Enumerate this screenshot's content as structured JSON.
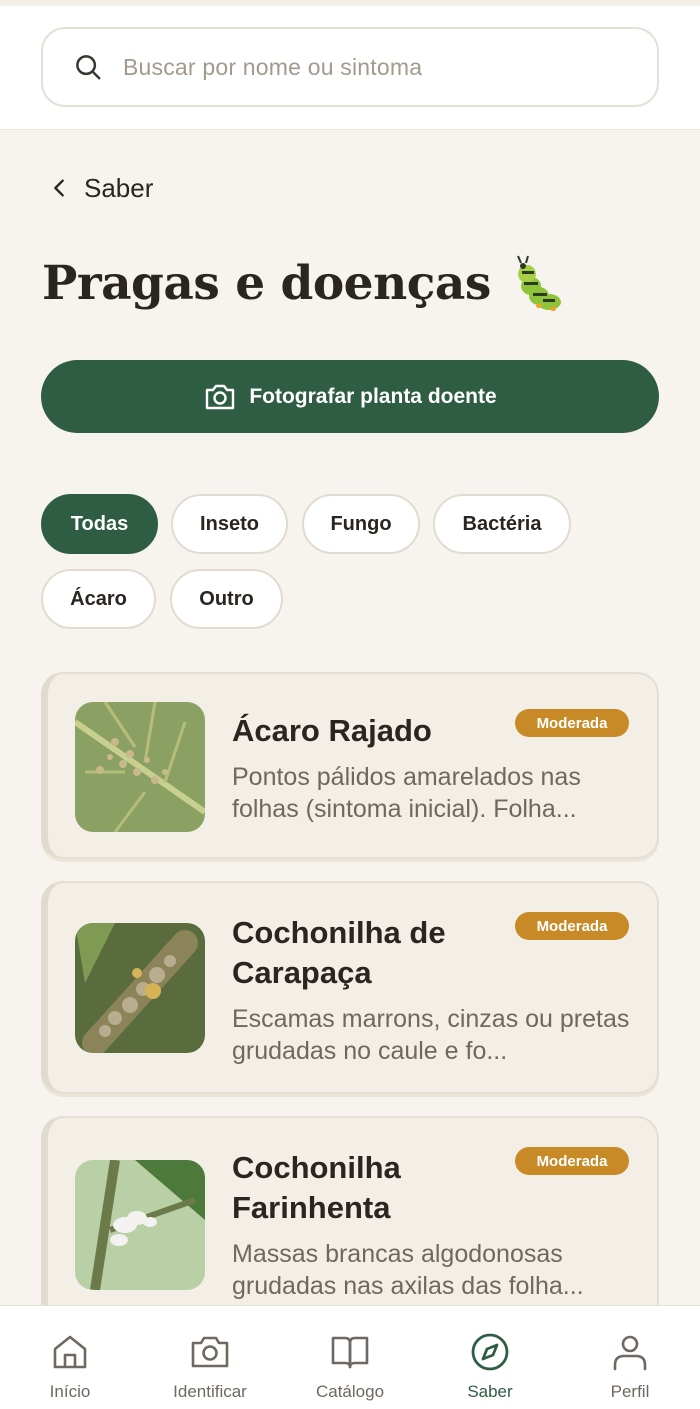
{
  "search": {
    "placeholder": "Buscar por nome ou sintoma"
  },
  "back": {
    "label": "Saber"
  },
  "page": {
    "title": "Pragas e doenças"
  },
  "cta": {
    "label": "Fotografar planta doente"
  },
  "filters": [
    "Todas",
    "Inseto",
    "Fungo",
    "Bactéria",
    "Ácaro",
    "Outro"
  ],
  "active_filter": "Todas",
  "items": [
    {
      "name": "Ácaro Rajado",
      "severity": "Moderada",
      "description": "Pontos pálidos amarelados nas folhas (sintoma inicial). Folha..."
    },
    {
      "name": "Cochonilha de Carapaça",
      "severity": "Moderada",
      "description": "Escamas marrons, cinzas ou pretas grudadas no caule e fo..."
    },
    {
      "name": "Cochonilha Farinhenta",
      "severity": "Moderada",
      "description": "Massas brancas algodonosas grudadas nas axilas das folha..."
    }
  ],
  "nav": {
    "items": [
      {
        "label": "Início",
        "icon": "home-icon"
      },
      {
        "label": "Identificar",
        "icon": "camera-icon"
      },
      {
        "label": "Catálogo",
        "icon": "book-icon"
      },
      {
        "label": "Saber",
        "icon": "compass-icon"
      },
      {
        "label": "Perfil",
        "icon": "user-icon"
      }
    ],
    "active": "Saber"
  },
  "colors": {
    "primary": "#2f5d43",
    "badge": "#c88a26",
    "background": "#f7f4ef"
  }
}
